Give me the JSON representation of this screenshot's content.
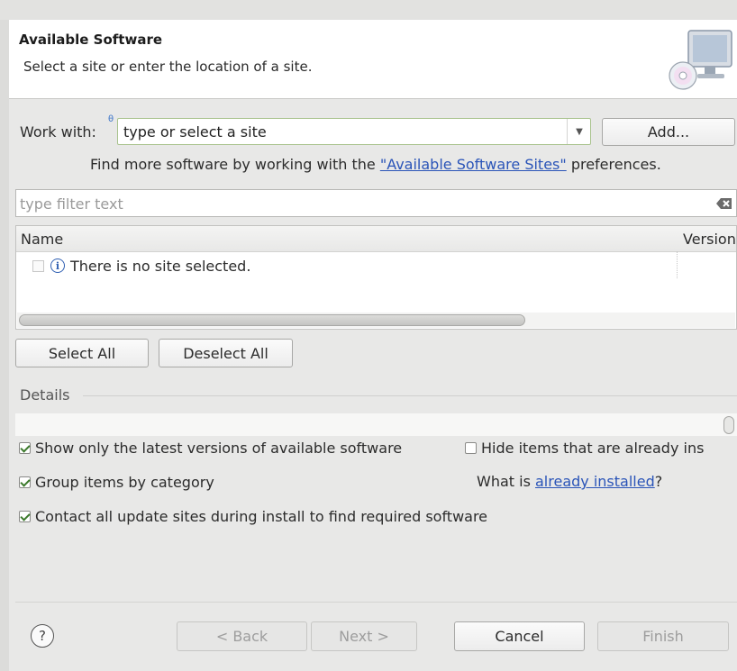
{
  "banner": {
    "title": "Available Software",
    "description": "Select a site or enter the location of a site."
  },
  "work_with": {
    "label": "Work with:",
    "value": "type or select a site",
    "add_label": "Add...",
    "find_more_prefix": "Find more software by working with the ",
    "find_more_link": "\"Available Software Sites\"",
    "find_more_suffix": " preferences."
  },
  "filter": {
    "placeholder": "type filter text"
  },
  "tree": {
    "columns": [
      "Name",
      "Version"
    ],
    "rows": [
      {
        "label": "There is no site selected."
      }
    ]
  },
  "selection_buttons": {
    "select_all": "Select All",
    "deselect_all": "Deselect All"
  },
  "details": {
    "label": "Details"
  },
  "options": {
    "latest_versions": {
      "label": "Show only the latest versions of available software",
      "checked": true
    },
    "hide_installed": {
      "label": "Hide items that are already ins",
      "checked": false
    },
    "group_by_category": {
      "label": "Group items by category",
      "checked": true
    },
    "already_installed_prefix": "What is ",
    "already_installed_link": "already installed",
    "already_installed_suffix": "?",
    "contact_sites": {
      "label": "Contact all update sites during install to find required software",
      "checked": true
    }
  },
  "footer": {
    "help_symbol": "?",
    "back": "< Back",
    "next": "Next >",
    "cancel": "Cancel",
    "finish": "Finish"
  },
  "colors": {
    "link": "#2a54b8",
    "check": "#3c7a2c",
    "info": "#2f5fb2"
  }
}
